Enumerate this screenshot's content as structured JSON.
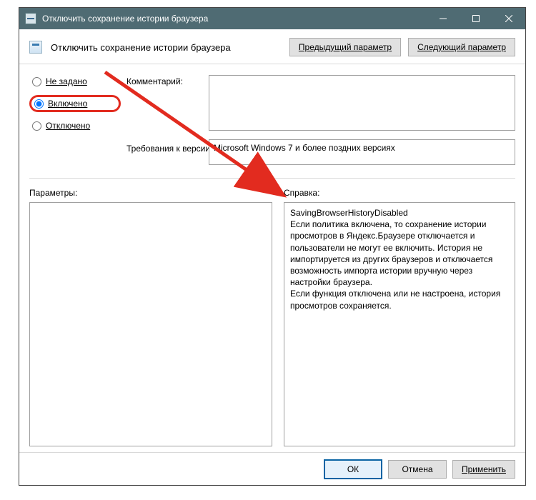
{
  "titlebar": {
    "title": "Отключить сохранение истории браузера"
  },
  "header": {
    "title": "Отключить сохранение истории браузера",
    "prev_btn": "Предыдущий параметр",
    "next_btn": "Следующий параметр"
  },
  "radios": {
    "not_configured": "Не задано",
    "enabled": "Включено",
    "disabled": "Отключено",
    "selected": "enabled"
  },
  "labels": {
    "comment": "Комментарий:",
    "requirements": "Требования к версии:",
    "params": "Параметры:",
    "help": "Справка:"
  },
  "fields": {
    "comment": "",
    "requirements": "Microsoft Windows 7 и более поздних версиях"
  },
  "help_text": "SavingBrowserHistoryDisabled\nЕсли политика включена, то сохранение истории просмотров в Яндекс.Браузере отключается и пользователи не могут ее включить. История не импортируется из других браузеров и отключается возможность импорта истории вручную через настройки браузера.\nЕсли функция отключена или не настроена, история просмотров сохраняется.",
  "footer": {
    "ok": "ОК",
    "cancel": "Отмена",
    "apply": "Применить"
  }
}
